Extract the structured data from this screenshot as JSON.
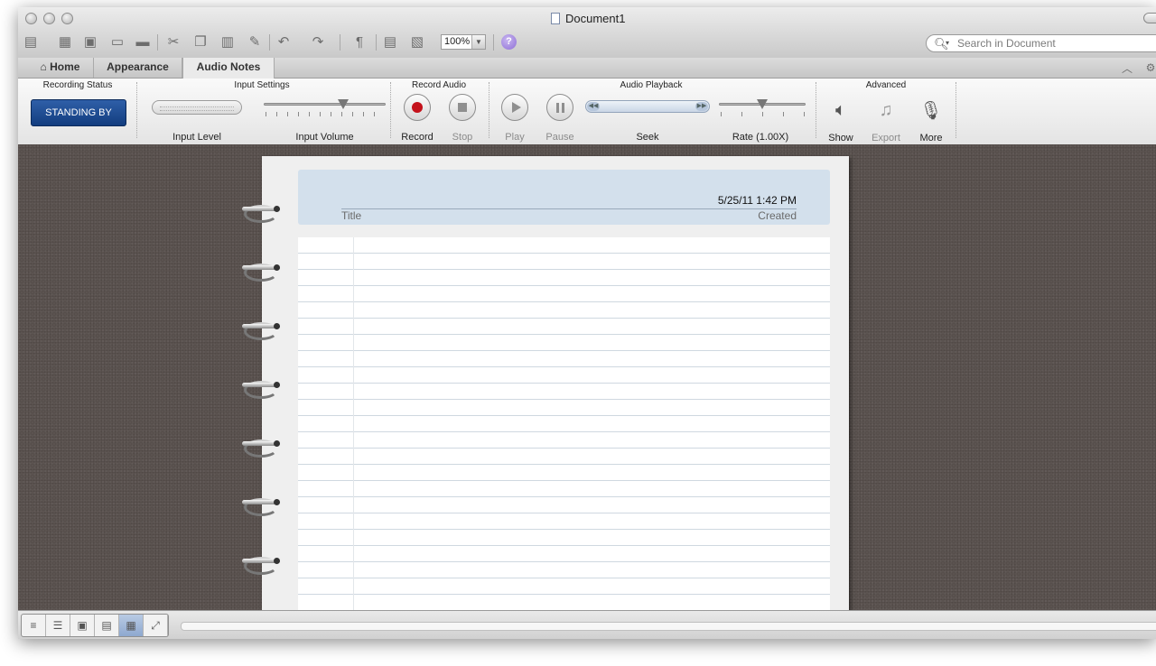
{
  "window": {
    "title": "Document1"
  },
  "toolbar": {
    "zoom_value": "100%",
    "search_placeholder": "Search in Document",
    "icons": [
      "new-icon",
      "gallery-icon",
      "save-icon",
      "open-icon",
      "print-icon",
      "cut-icon",
      "copy-icon",
      "paste-icon",
      "format-painter-icon",
      "undo-icon",
      "redo-icon",
      "pilcrow-icon",
      "sidebar-icon",
      "media-icon"
    ]
  },
  "tabs": [
    {
      "label": "Home"
    },
    {
      "label": "Appearance"
    },
    {
      "label": "Audio Notes"
    }
  ],
  "ribbon": {
    "recording_status": {
      "title": "Recording Status",
      "button": "STANDING BY"
    },
    "input_settings": {
      "title": "Input Settings",
      "level_label": "Input Level",
      "volume_label": "Input Volume"
    },
    "record_audio": {
      "title": "Record Audio",
      "record_label": "Record",
      "stop_label": "Stop"
    },
    "audio_playback": {
      "title": "Audio Playback",
      "play_label": "Play",
      "pause_label": "Pause",
      "seek_label": "Seek",
      "rate_label": "Rate (1.00X)"
    },
    "advanced": {
      "title": "Advanced",
      "show_label": "Show",
      "export_label": "Export",
      "more_label": "More"
    }
  },
  "page": {
    "date": "5/25/11 1:42 PM",
    "title_label": "Title",
    "created_label": "Created"
  },
  "colors": {
    "status_button": "#1f4c93",
    "record_dot": "#c4121b",
    "header_box": "#d3e0ec",
    "desk": "#5b5350"
  }
}
